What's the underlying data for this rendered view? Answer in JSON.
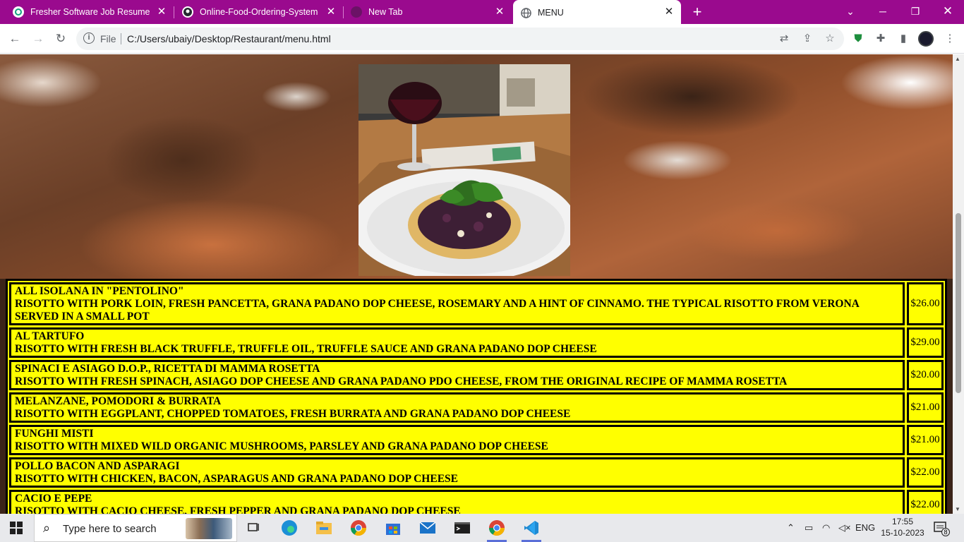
{
  "browser": {
    "tabs": [
      {
        "title": "Fresher Software Job Resume",
        "icon": "chatgpt-icon",
        "active": false
      },
      {
        "title": "Online-Food-Ordering-System-U",
        "icon": "github-icon",
        "active": false
      },
      {
        "title": "New Tab",
        "icon": "chrome-newtab-icon",
        "active": false
      },
      {
        "title": "MENU",
        "icon": "globe-icon",
        "active": true
      }
    ],
    "address": {
      "scheme_label": "File",
      "url": "C:/Users/ubaiy/Desktop/Restaurant/menu.html"
    }
  },
  "page": {
    "hero_image": "risotto-dish-photo",
    "menu": [
      {
        "name": "ALL ISOLANA IN \"PENTOLINO\"",
        "description": "RISOTTO WITH PORK LOIN, FRESH PANCETTA, GRANA PADANO DOP CHEESE, ROSEMARY AND A HINT OF CINNAMO. THE TYPICAL RISOTTO FROM VERONA SERVED IN A SMALL POT",
        "price": "$26.00"
      },
      {
        "name": "AL TARTUFO",
        "description": "RISOTTO WITH FRESH BLACK TRUFFLE, TRUFFLE OIL, TRUFFLE SAUCE AND GRANA PADANO DOP CHEESE",
        "price": "$29.00"
      },
      {
        "name": "SPINACI E ASIAGO D.O.P., RICETTA DI MAMMA ROSETTA",
        "description": "RISOTTO WITH FRESH SPINACH, ASIAGO DOP CHEESE AND GRANA PADANO PDO CHEESE, FROM THE ORIGINAL RECIPE OF MAMMA ROSETTA",
        "price": "$20.00"
      },
      {
        "name": "MELANZANE, POMODORI & BURRATA",
        "description": "RISOTTO WITH EGGPLANT, CHOPPED TOMATOES, FRESH BURRATA AND GRANA PADANO DOP CHEESE",
        "price": "$21.00"
      },
      {
        "name": "FUNGHI MISTI",
        "description": "RISOTTO WITH MIXED WILD ORGANIC MUSHROOMS, PARSLEY AND GRANA PADANO DOP CHEESE",
        "price": "$21.00"
      },
      {
        "name": "POLLO BACON AND ASPARAGI",
        "description": "RISOTTO WITH CHICKEN, BACON, ASPARAGUS AND GRANA PADANO DOP CHEESE",
        "price": "$22.00"
      },
      {
        "name": "CACIO E PEPE",
        "description": "RISOTTO WITH CACIO CHEESE, FRESH PEPPER AND GRANA PADANO DOP CHEESE",
        "price": "$22.00"
      }
    ],
    "colors": {
      "table_bg": "#ffff00",
      "border": "#000000",
      "tab_strip": "#9a0a8e"
    }
  },
  "taskbar": {
    "search_placeholder": "Type here to search",
    "apps": [
      "task-view-icon",
      "edge-icon",
      "file-explorer-icon",
      "chrome-icon",
      "microsoft-store-icon",
      "mail-icon",
      "terminal-icon",
      "chrome-icon",
      "vscode-icon"
    ],
    "language": "ENG",
    "time": "17:55",
    "date": "15-10-2023",
    "notification_count": "8"
  }
}
